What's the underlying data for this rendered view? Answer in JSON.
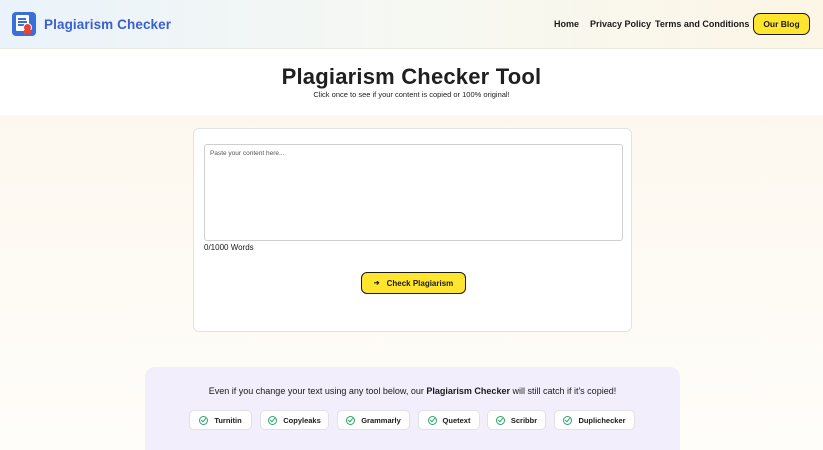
{
  "header": {
    "brand": "Plagiarism Checker",
    "nav": {
      "home": "Home",
      "privacy": "Privacy Policy",
      "terms": "Terms and Conditions",
      "blog": "Our Blog"
    }
  },
  "hero": {
    "title": "Plagiarism Checker Tool",
    "subtitle": "Click once to see if your content is copied or 100% original!"
  },
  "checker": {
    "placeholder": "Paste your content here...",
    "word_count": "0/1000 Words",
    "button_label": "Check Plagiarism",
    "button_icon": "arrow-right-icon"
  },
  "tools": {
    "text_before": "Even if you change your text using any tool below, our ",
    "text_bold": "Plagiarism Checker",
    "text_after": " will still catch if it's copied!",
    "items": [
      "Turnitin",
      "Copyleaks",
      "Grammarly",
      "Quetext",
      "Scribbr",
      "Duplichecker"
    ],
    "item_icon": "check-circle-icon"
  },
  "colors": {
    "accent_yellow": "#ffe52e",
    "brand_blue": "#3a5fd0",
    "check_green": "#2fa36b",
    "panel_lavender": "#f2eefb"
  }
}
